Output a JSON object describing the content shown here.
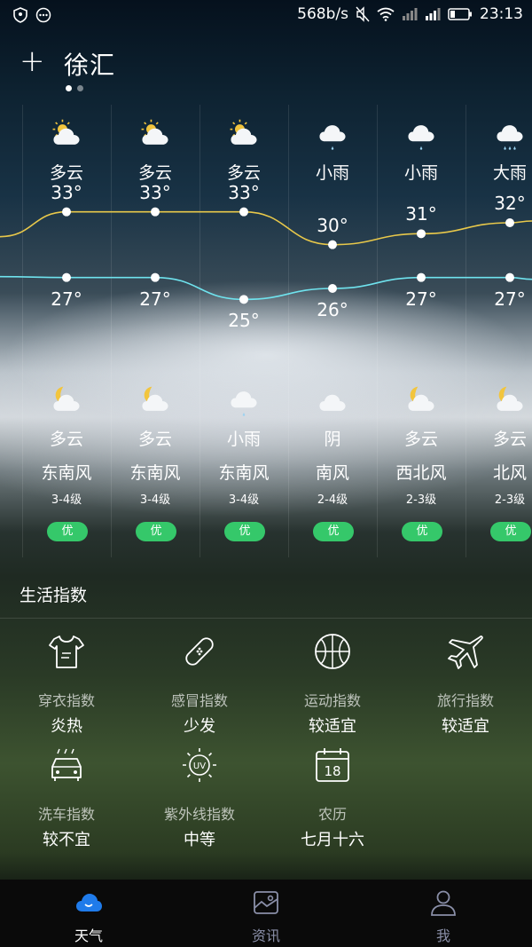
{
  "status_bar": {
    "net_speed": "568b/s",
    "time": "23:13"
  },
  "header": {
    "add_symbol": "+",
    "city": "徐汇",
    "page_count": 2,
    "active_page": 1
  },
  "forecast": {
    "days": [
      {
        "day_icon": "partly-cloudy-sun-icon",
        "day_cond": "多云",
        "high": "33°",
        "low": "27°",
        "night_icon": "partly-cloudy-moon-icon",
        "night_cond": "多云",
        "wind": "东南风",
        "wind_level": "3-4级",
        "aqi": "优"
      },
      {
        "day_icon": "partly-cloudy-sun-icon",
        "day_cond": "多云",
        "high": "33°",
        "low": "27°",
        "night_icon": "partly-cloudy-moon-icon",
        "night_cond": "多云",
        "wind": "东南风",
        "wind_level": "3-4级",
        "aqi": "优"
      },
      {
        "day_icon": "partly-cloudy-sun-icon",
        "day_cond": "多云",
        "high": "33°",
        "low": "25°",
        "night_icon": "light-rain-icon",
        "night_cond": "小雨",
        "wind": "东南风",
        "wind_level": "3-4级",
        "aqi": "优"
      },
      {
        "day_icon": "light-rain-icon",
        "day_cond": "小雨",
        "high": "30°",
        "low": "26°",
        "night_icon": "cloud-icon",
        "night_cond": "阴",
        "wind": "南风",
        "wind_level": "2-4级",
        "aqi": "优"
      },
      {
        "day_icon": "light-rain-icon",
        "day_cond": "小雨",
        "high": "31°",
        "low": "27°",
        "night_icon": "partly-cloudy-moon-icon",
        "night_cond": "多云",
        "wind": "西北风",
        "wind_level": "2-3级",
        "aqi": "优"
      },
      {
        "day_icon": "heavy-rain-icon",
        "day_cond": "大雨",
        "high": "32°",
        "low": "27°",
        "night_icon": "partly-cloudy-moon-icon",
        "night_cond": "多云",
        "wind": "北风",
        "wind_level": "2-3级",
        "aqi": "优"
      }
    ],
    "high_temps": [
      33,
      33,
      33,
      30,
      31,
      32
    ],
    "low_temps": [
      27,
      27,
      25,
      26,
      27,
      27
    ],
    "high_color": "#e8c84a",
    "low_color": "#6fe3ee",
    "aqi_color": "#35c86a"
  },
  "life_index": {
    "title": "生活指数",
    "items": [
      {
        "icon": "tshirt-icon",
        "label": "穿衣指数",
        "value": "炎热"
      },
      {
        "icon": "bandage-icon",
        "label": "感冒指数",
        "value": "少发"
      },
      {
        "icon": "basketball-icon",
        "label": "运动指数",
        "value": "较适宜"
      },
      {
        "icon": "airplane-icon",
        "label": "旅行指数",
        "value": "较适宜"
      },
      {
        "icon": "car-wash-icon",
        "label": "洗车指数",
        "value": "较不宜"
      },
      {
        "icon": "uv-sun-icon",
        "label": "紫外线指数",
        "value": "中等"
      },
      {
        "icon": "calendar-icon",
        "label": "农历",
        "value": "七月十六",
        "icon_text": "18"
      }
    ]
  },
  "tab_bar": {
    "tabs": [
      {
        "icon": "cloud-weather-icon",
        "label": "天气",
        "active": true
      },
      {
        "icon": "picture-icon",
        "label": "资讯",
        "active": false
      },
      {
        "icon": "person-icon",
        "label": "我",
        "active": false
      }
    ],
    "active_color": "#1f7bea"
  }
}
